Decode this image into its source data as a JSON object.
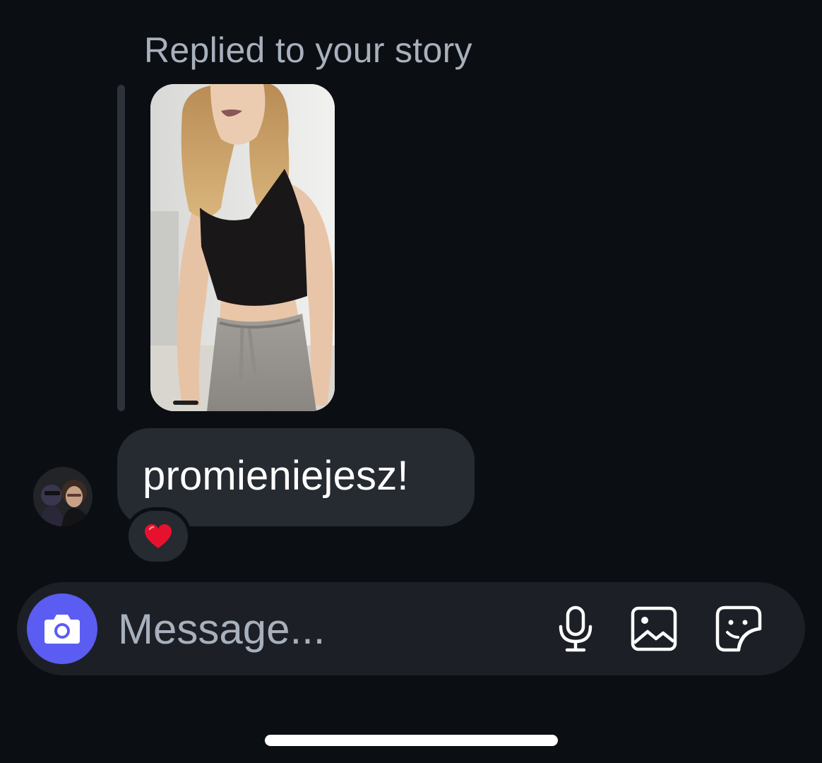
{
  "thread": {
    "reply_header": "Replied to your story",
    "message_text": "promieniejesz!",
    "reaction_emoji": "❤️"
  },
  "composer": {
    "placeholder": "Message..."
  },
  "icons": {
    "camera": "camera-icon",
    "mic": "microphone-icon",
    "gallery": "gallery-icon",
    "sticker": "sticker-icon"
  },
  "colors": {
    "background": "#0b0e13",
    "bubble": "#262a31",
    "composer": "#1c2026",
    "camera_button": "#5b5cf2",
    "secondary_text": "#a8b0bc"
  }
}
